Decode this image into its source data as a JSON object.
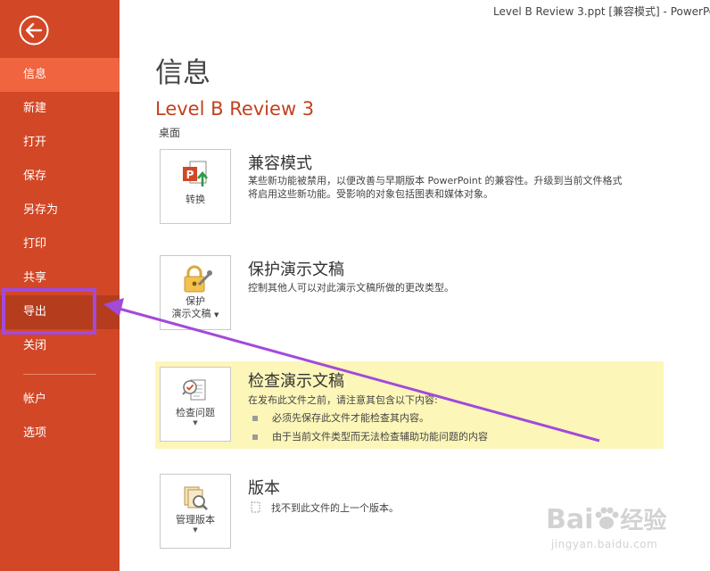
{
  "window": {
    "title": "Level B Review 3.ppt [兼容模式] - PowerPo"
  },
  "sidebar": {
    "items": [
      {
        "label": "信息"
      },
      {
        "label": "新建"
      },
      {
        "label": "打开"
      },
      {
        "label": "保存"
      },
      {
        "label": "另存为"
      },
      {
        "label": "打印"
      },
      {
        "label": "共享"
      },
      {
        "label": "导出"
      },
      {
        "label": "关闭"
      },
      {
        "label": "帐户"
      },
      {
        "label": "选项"
      }
    ]
  },
  "page": {
    "heading": "信息",
    "doc_title": "Level B Review 3",
    "location": "桌面"
  },
  "sections": {
    "compat": {
      "button_label": "转换",
      "title": "兼容模式",
      "desc_line1": "某些新功能被禁用，以便改善与早期版本 PowerPoint 的兼容性。升级到当前文件格式",
      "desc_line2": "将启用这些新功能。受影响的对象包括图表和媒体对象。"
    },
    "protect": {
      "button_label_1": "保护",
      "button_label_2": "演示文稿",
      "title": "保护演示文稿",
      "desc": "控制其他人可以对此演示文稿所做的更改类型。"
    },
    "inspect": {
      "button_label": "检查问题",
      "title": "检查演示文稿",
      "desc": "在发布此文件之前，请注意其包含以下内容:",
      "bullets": [
        "必须先保存此文件才能检查其内容。",
        "由于当前文件类型而无法检查辅助功能问题的内容"
      ]
    },
    "versions": {
      "button_label": "管理版本",
      "title": "版本",
      "desc": "找不到此文件的上一个版本。"
    }
  },
  "watermark": {
    "brand_left": "Bai",
    "brand_right": "经验",
    "url": "jingyan.baidu.com"
  },
  "colors": {
    "sidebar_bg": "#d24726",
    "sidebar_active": "#f0643f",
    "accent_title": "#c3411f",
    "annotation": "#a24ad9",
    "highlight_bg": "#fdf6b9"
  }
}
